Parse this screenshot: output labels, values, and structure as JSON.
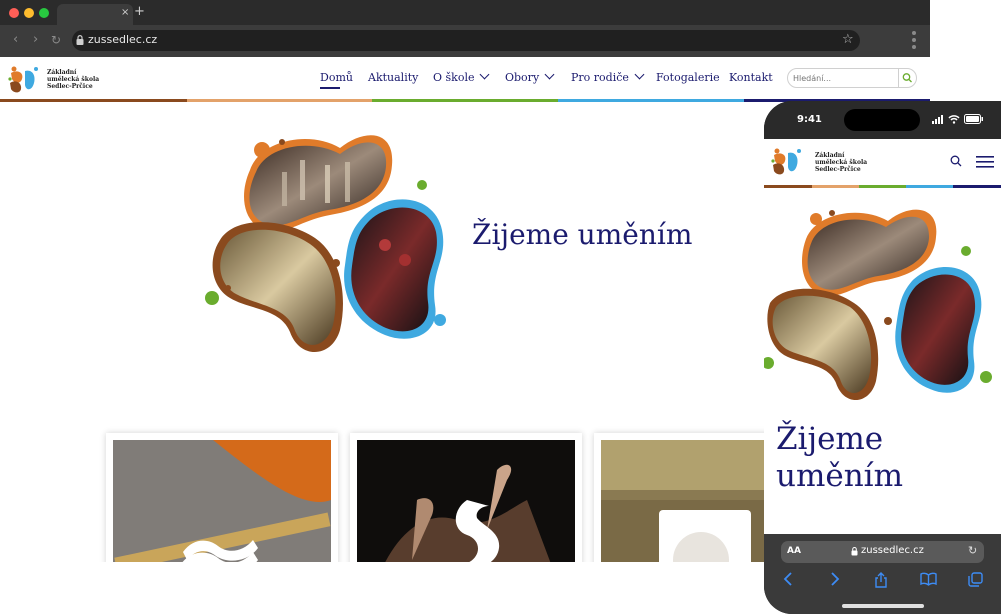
{
  "browser": {
    "url": "zussedlec.cz",
    "tab_close": "×",
    "tab_new": "+",
    "star": "☆",
    "back": "‹",
    "forward": "›",
    "reload": "↻"
  },
  "school": {
    "name_lines": [
      "Základní",
      "umělecká škola",
      "Sedlec-Prčice"
    ]
  },
  "nav": {
    "items": [
      "Domů",
      "Aktuality",
      "O škole",
      "Obory",
      "Pro rodiče",
      "Fotogalerie",
      "Kontakt"
    ]
  },
  "search": {
    "placeholder": "Hledání..."
  },
  "hero": {
    "title": "Žijeme uměním"
  },
  "mobile": {
    "time": "9:41",
    "title_lines": [
      "Žijeme",
      "uměním"
    ],
    "safari_aa": "AA",
    "safari_domain": "zussedlec.cz",
    "safari_reload": "↻"
  },
  "colors": {
    "navy": "#1b1b6e",
    "orange": "#e07b2a",
    "brown": "#8a4a1e",
    "green": "#6aac2e",
    "blue": "#3fa9e0"
  }
}
